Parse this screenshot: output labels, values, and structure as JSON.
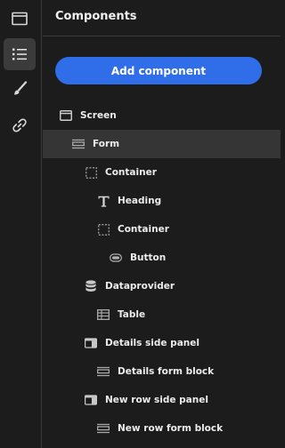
{
  "rail": {
    "items": [
      {
        "icon": "screen-icon",
        "active": false
      },
      {
        "icon": "component-tree-icon",
        "active": true
      },
      {
        "icon": "paintbrush-icon",
        "active": false
      },
      {
        "icon": "link-icon",
        "active": false
      }
    ]
  },
  "panel": {
    "title": "Components",
    "add_button_label": "Add component"
  },
  "tree": {
    "items": [
      {
        "label": "Screen",
        "icon": "screen-icon",
        "depth": 0
      },
      {
        "label": "Form",
        "icon": "form-icon",
        "depth": 1,
        "selected": true
      },
      {
        "label": "Container",
        "icon": "container-icon",
        "depth": 2
      },
      {
        "label": "Heading",
        "icon": "heading-icon",
        "depth": 3
      },
      {
        "label": "Container",
        "icon": "container-icon",
        "depth": 3
      },
      {
        "label": "Button",
        "icon": "button-icon",
        "depth": 4
      },
      {
        "label": "Dataprovider",
        "icon": "database-icon",
        "depth": 2
      },
      {
        "label": "Table",
        "icon": "table-icon",
        "depth": 3
      },
      {
        "label": "Details side panel",
        "icon": "side-panel-icon",
        "depth": 2
      },
      {
        "label": "Details form block",
        "icon": "form-icon",
        "depth": 3
      },
      {
        "label": "New row side panel",
        "icon": "side-panel-icon",
        "depth": 2
      },
      {
        "label": "New row form block",
        "icon": "form-icon",
        "depth": 3
      }
    ]
  },
  "colors": {
    "accent": "#2f6ee8",
    "background": "#1c1c1c",
    "selected_row": "#353535",
    "text": "#ececec"
  }
}
